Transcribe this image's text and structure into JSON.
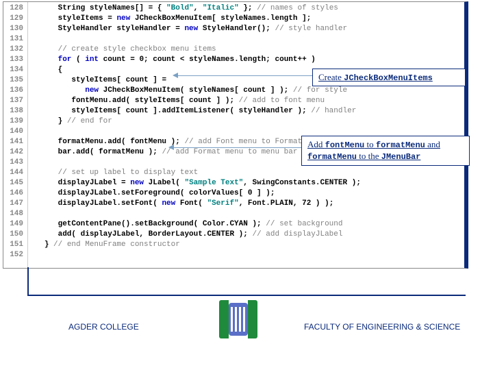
{
  "lines": [
    {
      "n": "128",
      "indent": 2,
      "tokens": [
        {
          "c": "type",
          "t": "String"
        },
        {
          "c": "",
          "t": " styleNames[] = { "
        },
        {
          "c": "str",
          "t": "\"Bold\""
        },
        {
          "c": "",
          "t": ", "
        },
        {
          "c": "str",
          "t": "\"Italic\""
        },
        {
          "c": "",
          "t": " }; "
        },
        {
          "c": "cmt",
          "t": "// names of styles"
        }
      ]
    },
    {
      "n": "129",
      "indent": 2,
      "tokens": [
        {
          "c": "",
          "t": "styleItems = "
        },
        {
          "c": "kw",
          "t": "new"
        },
        {
          "c": "",
          "t": " JCheckBoxMenuItem[ styleNames.length ];"
        }
      ]
    },
    {
      "n": "130",
      "indent": 2,
      "tokens": [
        {
          "c": "",
          "t": "StyleHandler styleHandler = "
        },
        {
          "c": "kw",
          "t": "new"
        },
        {
          "c": "",
          "t": " StyleHandler(); "
        },
        {
          "c": "cmt",
          "t": "// style handler"
        }
      ]
    },
    {
      "n": "131",
      "indent": 0,
      "tokens": []
    },
    {
      "n": "132",
      "indent": 2,
      "tokens": [
        {
          "c": "cmt",
          "t": "// create style checkbox menu items"
        }
      ]
    },
    {
      "n": "133",
      "indent": 2,
      "tokens": [
        {
          "c": "kw",
          "t": "for"
        },
        {
          "c": "",
          "t": " ( "
        },
        {
          "c": "kw",
          "t": "int"
        },
        {
          "c": "",
          "t": " count = 0; count < styleNames.length; count++ )"
        }
      ]
    },
    {
      "n": "134",
      "indent": 2,
      "tokens": [
        {
          "c": "",
          "t": "{"
        }
      ]
    },
    {
      "n": "135",
      "indent": 3,
      "tokens": [
        {
          "c": "",
          "t": "styleItems[ count ] ="
        }
      ]
    },
    {
      "n": "136",
      "indent": 4,
      "tokens": [
        {
          "c": "kw",
          "t": "new"
        },
        {
          "c": "",
          "t": " JCheckBoxMenuItem( styleNames[ count ] ); "
        },
        {
          "c": "cmt",
          "t": "// for style"
        }
      ]
    },
    {
      "n": "137",
      "indent": 3,
      "tokens": [
        {
          "c": "",
          "t": "fontMenu.add( styleItems[ count ] ); "
        },
        {
          "c": "cmt",
          "t": "// add to font menu"
        }
      ]
    },
    {
      "n": "138",
      "indent": 3,
      "tokens": [
        {
          "c": "",
          "t": "styleItems[ count ].addItemListener( styleHandler ); "
        },
        {
          "c": "cmt",
          "t": "// handler"
        }
      ]
    },
    {
      "n": "139",
      "indent": 2,
      "tokens": [
        {
          "c": "",
          "t": "} "
        },
        {
          "c": "cmt",
          "t": "// end for"
        }
      ]
    },
    {
      "n": "140",
      "indent": 0,
      "tokens": []
    },
    {
      "n": "141",
      "indent": 2,
      "tokens": [
        {
          "c": "",
          "t": "formatMenu.add( fontMenu ); "
        },
        {
          "c": "cmt",
          "t": "// add Font menu to Format menu"
        }
      ]
    },
    {
      "n": "142",
      "indent": 2,
      "tokens": [
        {
          "c": "",
          "t": "bar.add( formatMenu ); "
        },
        {
          "c": "cmt",
          "t": "// add Format menu to menu bar"
        }
      ]
    },
    {
      "n": "143",
      "indent": 0,
      "tokens": []
    },
    {
      "n": "144",
      "indent": 2,
      "tokens": [
        {
          "c": "cmt",
          "t": "// set up label to display text"
        }
      ]
    },
    {
      "n": "145",
      "indent": 2,
      "tokens": [
        {
          "c": "",
          "t": "displayJLabel = "
        },
        {
          "c": "kw",
          "t": "new"
        },
        {
          "c": "",
          "t": " JLabel( "
        },
        {
          "c": "str",
          "t": "\"Sample Text\""
        },
        {
          "c": "",
          "t": ", SwingConstants.CENTER );"
        }
      ]
    },
    {
      "n": "146",
      "indent": 2,
      "tokens": [
        {
          "c": "",
          "t": "displayJLabel.setForeground( colorValues[ 0 ] );"
        }
      ]
    },
    {
      "n": "147",
      "indent": 2,
      "tokens": [
        {
          "c": "",
          "t": "displayJLabel.setFont( "
        },
        {
          "c": "kw",
          "t": "new"
        },
        {
          "c": "",
          "t": " Font( "
        },
        {
          "c": "str",
          "t": "\"Serif\""
        },
        {
          "c": "",
          "t": ", Font.PLAIN, 72 ) );"
        }
      ]
    },
    {
      "n": "148",
      "indent": 0,
      "tokens": []
    },
    {
      "n": "149",
      "indent": 2,
      "tokens": [
        {
          "c": "",
          "t": "getContentPane().setBackground( Color.CYAN ); "
        },
        {
          "c": "cmt",
          "t": "// set background"
        }
      ]
    },
    {
      "n": "150",
      "indent": 2,
      "tokens": [
        {
          "c": "",
          "t": "add( displayJLabel, BorderLayout.CENTER ); "
        },
        {
          "c": "cmt",
          "t": "// add displayJLabel"
        }
      ]
    },
    {
      "n": "151",
      "indent": 1,
      "tokens": [
        {
          "c": "",
          "t": "} "
        },
        {
          "c": "cmt",
          "t": "// end MenuFrame constructor"
        }
      ]
    },
    {
      "n": "152",
      "indent": 0,
      "tokens": []
    }
  ],
  "callout1": {
    "pre": "Create ",
    "mono": "JCheckBoxMenuItems"
  },
  "callout2": {
    "w1": "Add ",
    "m1": "fontMenu",
    "w2": " to ",
    "m2": "formatMenu",
    "w3": " and ",
    "m3": "formatMenu",
    "w4": " to the ",
    "m4": "JMenuBar"
  },
  "footer_left": "AGDER COLLEGE",
  "footer_right": "FACULTY OF ENGINEERING & SCIENCE"
}
